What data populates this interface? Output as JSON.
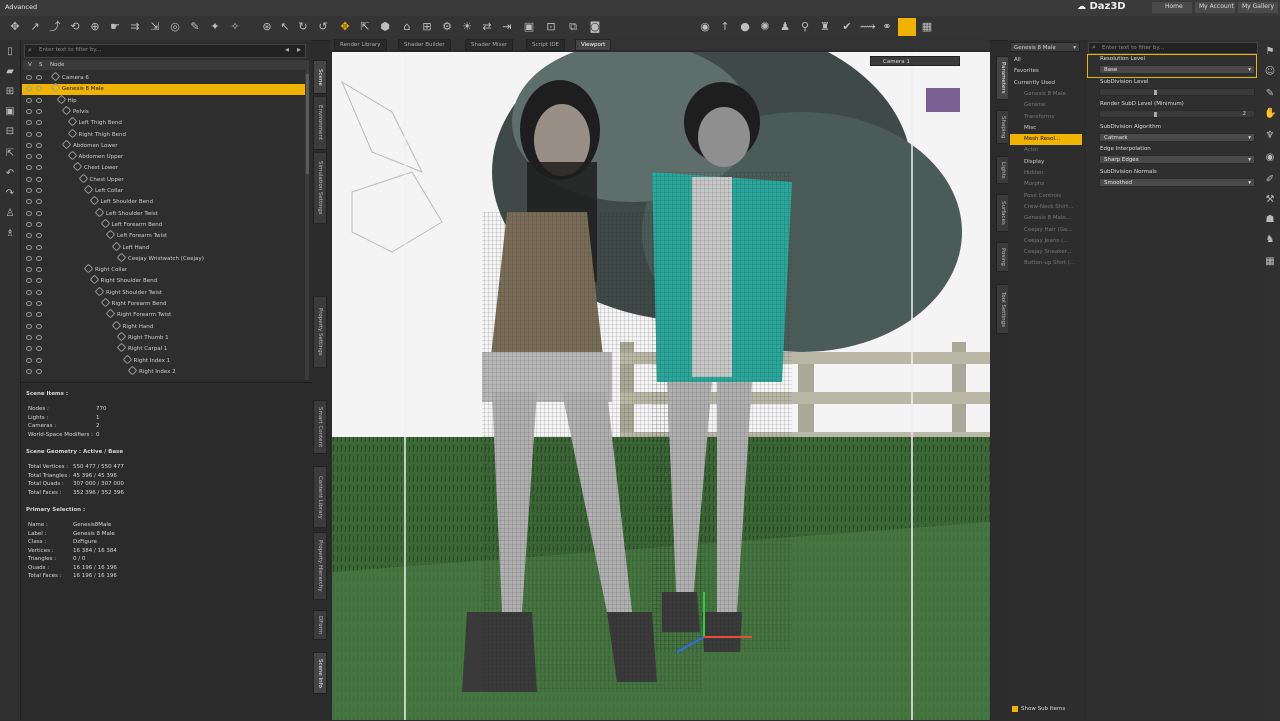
{
  "titlebar": {
    "workspace": "Advanced",
    "brand": "Daz3D",
    "links": [
      "Home",
      "My Account",
      "My Gallery"
    ]
  },
  "scene": {
    "filter_placeholder": "Enter text to filter by...",
    "columns": [
      "V",
      "S",
      "Node"
    ],
    "nodes": [
      {
        "label": "Camera 6",
        "indent": 0,
        "type": "camera"
      },
      {
        "label": "Genesis 8 Male",
        "indent": 0,
        "type": "figure",
        "selected": true
      },
      {
        "label": "Hip",
        "indent": 1
      },
      {
        "label": "Pelvis",
        "indent": 2
      },
      {
        "label": "Left Thigh Bend",
        "indent": 3
      },
      {
        "label": "Right Thigh Bend",
        "indent": 3
      },
      {
        "label": "Abdomen Lower",
        "indent": 2
      },
      {
        "label": "Abdomen Upper",
        "indent": 3
      },
      {
        "label": "Chest Lower",
        "indent": 4
      },
      {
        "label": "Chest Upper",
        "indent": 5
      },
      {
        "label": "Left Collar",
        "indent": 6
      },
      {
        "label": "Left Shoulder Bend",
        "indent": 7
      },
      {
        "label": "Left Shoulder Twist",
        "indent": 8
      },
      {
        "label": "Left Forearm Bend",
        "indent": 9
      },
      {
        "label": "Left Forearm Twist",
        "indent": 10
      },
      {
        "label": "Left Hand",
        "indent": 11
      },
      {
        "label": "Ceejay Wristwatch (Ceejay)",
        "indent": 12
      },
      {
        "label": "Right Collar",
        "indent": 6
      },
      {
        "label": "Right Shoulder Bend",
        "indent": 7
      },
      {
        "label": "Right Shoulder Twist",
        "indent": 8
      },
      {
        "label": "Right Forearm Bend",
        "indent": 9
      },
      {
        "label": "Right Forearm Twist",
        "indent": 10
      },
      {
        "label": "Right Hand",
        "indent": 11
      },
      {
        "label": "Right Thumb 1",
        "indent": 12
      },
      {
        "label": "Right Carpal 1",
        "indent": 12
      },
      {
        "label": "Right Index 1",
        "indent": 13
      },
      {
        "label": "Right Index 2",
        "indent": 14
      }
    ]
  },
  "left_vtabs_top": [
    "Scene",
    "Environment",
    "Simulation Settings",
    "Property Settings"
  ],
  "left_vtabs_bottom": [
    "Smart Content",
    "Content Library",
    "Property Hierarchy",
    "DForm",
    "Scene Info"
  ],
  "scene_info": {
    "items_title": "Scene Items :",
    "items": [
      [
        "Nodes :",
        "770"
      ],
      [
        "Lights :",
        "1"
      ],
      [
        "Cameras :",
        "2"
      ],
      [
        "World-Space Modifiers :",
        "0"
      ]
    ],
    "geometry_title": "Scene Geometry : Active / Base",
    "geometry": [
      [
        "Total Vertices :",
        "550 477 / 550 477"
      ],
      [
        "Total Triangles :",
        "45 396 / 45 396"
      ],
      [
        "Total Quads :",
        "307 000 / 307 000"
      ],
      [
        "Total Faces :",
        "352 396 / 352 396"
      ]
    ],
    "selection_title": "Primary Selection :",
    "selection": [
      [
        "Name :",
        "Genesis8Male"
      ],
      [
        "Label :",
        "Genesis 8 Male"
      ],
      [
        "Class :",
        "DzFigure"
      ],
      [
        "Vertices :",
        "16 384 / 16 384"
      ],
      [
        "Triangles :",
        "0 / 0"
      ],
      [
        "Quads :",
        "16 196 / 16 196"
      ],
      [
        "Total Faces :",
        "16 196 / 16 196"
      ]
    ]
  },
  "viewport_tabs": [
    "Render Library",
    "Shader Builder",
    "Shader Mixer",
    "Script IDE",
    "Viewport"
  ],
  "viewport": {
    "camera_label": "Camera 1"
  },
  "right_vtabs": [
    "Parameters",
    "Shaping",
    "Lights",
    "Surfaces",
    "Posing",
    "Tool Settings"
  ],
  "params_tree": {
    "figure_select": "Genesis 8 Male",
    "items": [
      {
        "label": "All",
        "state": "normal"
      },
      {
        "label": "Favorites",
        "state": "normal"
      },
      {
        "label": "Currently Used",
        "state": "normal"
      },
      {
        "label": "Genesis 8 Male",
        "state": "dim"
      },
      {
        "label": "General",
        "state": "dim"
      },
      {
        "label": "Transforms",
        "state": "dim"
      },
      {
        "label": "Misc",
        "state": "normal"
      },
      {
        "label": "Mesh Resol...",
        "state": "selected"
      },
      {
        "label": "Actor",
        "state": "dim"
      },
      {
        "label": "Display",
        "state": "normal"
      },
      {
        "label": "Hidden",
        "state": "dim"
      },
      {
        "label": "Morphs",
        "state": "dim"
      },
      {
        "label": "Pose Controls",
        "state": "dim"
      },
      {
        "label": "Crew-Neck Shirt...",
        "state": "dim"
      },
      {
        "label": "Genesis 8 Male...",
        "state": "dim"
      },
      {
        "label": "Ceejay Hair (Ge...",
        "state": "dim"
      },
      {
        "label": "Ceejay Jeans (...",
        "state": "dim"
      },
      {
        "label": "Ceejay Sneaker...",
        "state": "dim"
      },
      {
        "label": "Button-up Shirt (...",
        "state": "dim"
      }
    ],
    "show_sub_items": "Show Sub Items"
  },
  "params_props": {
    "filter_placeholder": "Enter text to filter by...",
    "resolution_level_label": "Resolution Level",
    "resolution_level_value": "Base",
    "subdivision_level_label": "SubDivision Level",
    "render_subd_label": "Render SubD Level (Minimum)",
    "render_subd_value": "2",
    "subdivision_algorithm_label": "SubDivision Algorithm",
    "subdivision_algorithm_value": "Catmark",
    "edge_interpolation_label": "Edge Interpolation",
    "edge_interpolation_value": "Sharp Edges",
    "subdivision_normals_label": "SubDivision Normals",
    "subdivision_normals_value": "Smoothed"
  },
  "colors": {
    "accent": "#f0b400",
    "grass": "#3c6b37",
    "sky": "#f4f4f4",
    "teal_shirt": "#2aa79a"
  }
}
